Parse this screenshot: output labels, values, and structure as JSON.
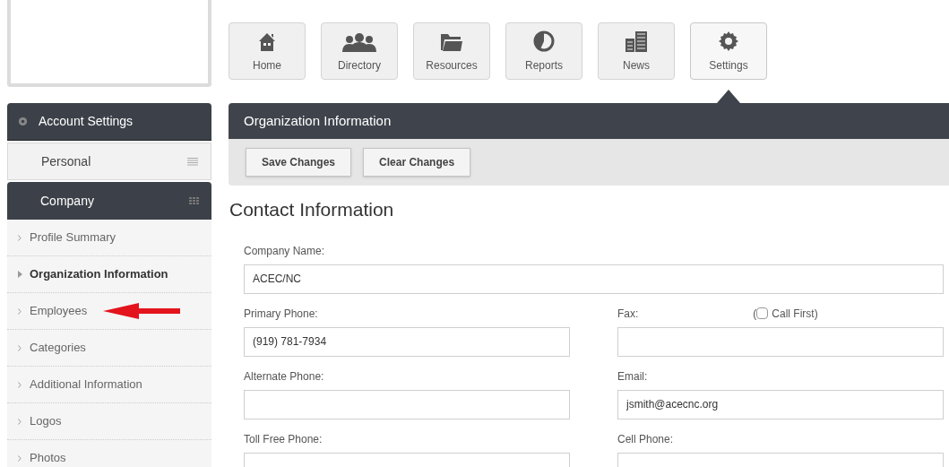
{
  "nav": [
    {
      "label": "Home",
      "selected": false
    },
    {
      "label": "Directory",
      "selected": false
    },
    {
      "label": "Resources",
      "selected": false
    },
    {
      "label": "Reports",
      "selected": false
    },
    {
      "label": "News",
      "selected": false
    },
    {
      "label": "Settings",
      "selected": true
    }
  ],
  "sidebar": {
    "header": "Account Settings",
    "sections": [
      {
        "label": "Personal",
        "expanded": false
      },
      {
        "label": "Company",
        "expanded": true
      }
    ],
    "items": [
      {
        "label": "Profile Summary",
        "selected": false,
        "annotated": false
      },
      {
        "label": "Organization Information",
        "selected": true,
        "annotated": false
      },
      {
        "label": "Employees",
        "selected": false,
        "annotated": true
      },
      {
        "label": "Categories",
        "selected": false,
        "annotated": false
      },
      {
        "label": "Additional Information",
        "selected": false,
        "annotated": false
      },
      {
        "label": "Logos",
        "selected": false,
        "annotated": false
      },
      {
        "label": "Photos",
        "selected": false,
        "annotated": false
      }
    ]
  },
  "panel": {
    "title": "Organization Information",
    "buttons": [
      "Save Changes",
      "Clear Changes"
    ]
  },
  "section_title": "Contact Information",
  "fields": [
    {
      "label": "Company Name:",
      "value": "ACEC/NC",
      "wide": true
    },
    {
      "label": "Primary Phone:",
      "value": "(919) 781-7934",
      "wide": false
    },
    {
      "label": "Fax:",
      "wide": false,
      "checkbox": {
        "open": "(",
        "label": "Call First)",
        "checked": false
      }
    },
    {
      "label": "Alternate Phone:",
      "wide": false
    },
    {
      "label": "Email:",
      "value": "jsmith@acecnc.org",
      "wide": false
    },
    {
      "label": "Toll Free Phone:",
      "wide": false
    },
    {
      "label": "Cell Phone:",
      "wide": false
    }
  ]
}
